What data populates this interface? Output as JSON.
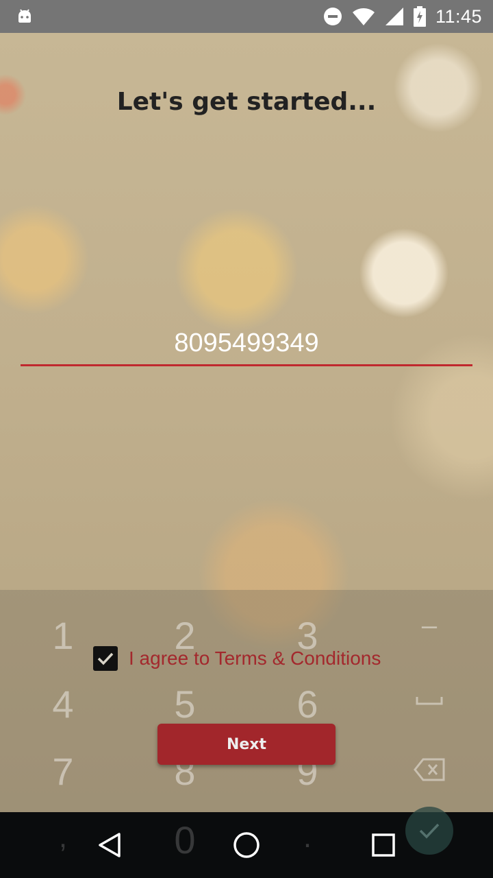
{
  "status_bar": {
    "time": "11:45",
    "icons": [
      "android-debug-icon",
      "do-not-disturb-icon",
      "wifi-icon",
      "cell-signal-icon",
      "battery-charging-icon"
    ]
  },
  "page": {
    "title": "Let's get started...",
    "phone_value": "8095499349",
    "terms_label": "I agree to Terms & Conditions",
    "terms_checked": true,
    "next_label": "Next"
  },
  "keyboard": {
    "row1": [
      "1",
      "2",
      "3",
      "–"
    ],
    "row2": [
      "4",
      "5",
      "6"
    ],
    "row3": [
      "7",
      "8",
      "9"
    ],
    "row4": [
      ",",
      "0",
      "."
    ]
  },
  "colors": {
    "accent": "#a2262b",
    "underline": "#c0282e",
    "status_bar": "#757575",
    "nav_bar": "#0a0c0d"
  }
}
